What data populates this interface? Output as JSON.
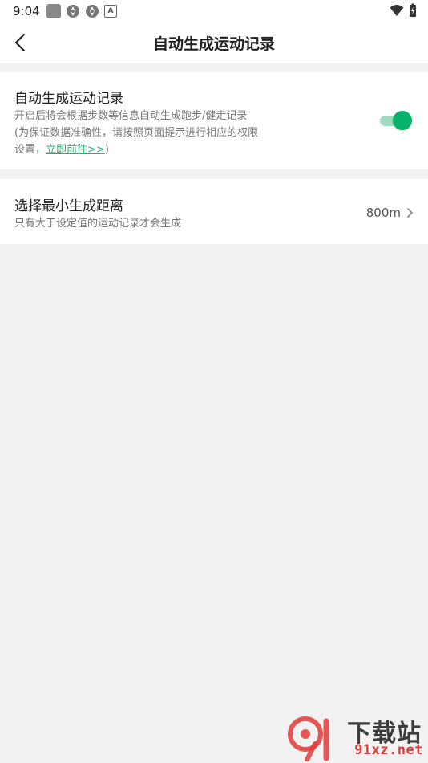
{
  "status_bar": {
    "time": "9:04",
    "left_icons": [
      "gray-square-icon",
      "aperture-icon",
      "aperture-icon",
      "a-badge-icon"
    ],
    "a_badge_text": "A",
    "right_icons": [
      "wifi-icon",
      "battery-charging-icon"
    ]
  },
  "nav": {
    "title": "自动生成运动记录",
    "back_icon": "chevron-left-icon"
  },
  "auto_record": {
    "title": "自动生成运动记录",
    "description_line1": "开启后将会根据步数等信息自动生成跑步/健走记录",
    "description_line2_prefix": "(为保证数据准确性，请按照页面提示进行相应的权限设置，",
    "link_text": "立即前往>>",
    "description_suffix": ")",
    "toggle_on": true,
    "toggle_color": "#07b36a"
  },
  "min_distance": {
    "title": "选择最小生成距离",
    "description": "只有大于设定值的运动记录才会生成",
    "value": "800m",
    "chevron_icon": "chevron-right-icon"
  },
  "watermark": {
    "main_text": "下载站",
    "sub_text": "91xz.net",
    "logo_text": "91"
  },
  "colors": {
    "accent": "#07b36a",
    "link": "#1db46a",
    "background": "#f2f2f2",
    "watermark_red": "#e23a3a"
  }
}
